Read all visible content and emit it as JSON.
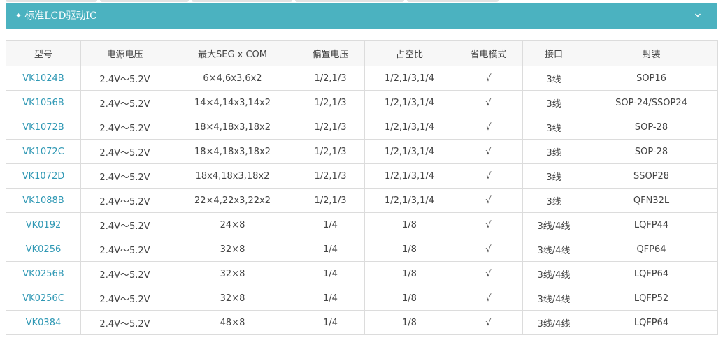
{
  "colors": {
    "header_bg": "#4bb2c0",
    "link": "#2f98b4",
    "border": "#dcdcdc",
    "th_bg": "#f7f7f7",
    "text": "#444444"
  },
  "panel": {
    "bullet": "✦",
    "title": "标准LCD驱动IC",
    "toggle_icon": "chevron-down-icon"
  },
  "table": {
    "headers": [
      "型号",
      "电源电压",
      "最大SEG x COM",
      "偏置电压",
      "占空比",
      "省电模式",
      "接口",
      "封装"
    ],
    "rows": [
      [
        "VK1024B",
        "2.4V～5.2V",
        "6×4,6x3,6x2",
        "1/2,1/3",
        "1/2,1/3,1/4",
        "√",
        "3线",
        "SOP16"
      ],
      [
        "VK1056B",
        "2.4V～5.2V",
        "14×4,14x3,14x2",
        "1/2,1/3",
        "1/2,1/3,1/4",
        "√",
        "3线",
        "SOP-24/SSOP24"
      ],
      [
        "VK1072B",
        "2.4V～5.2V",
        "18×4,18x3,18x2",
        "1/2,1/3",
        "1/2,1/3,1/4",
        "√",
        "3线",
        "SOP-28"
      ],
      [
        "VK1072C",
        "2.4V～5.2V",
        "18×4,18x3,18x2",
        "1/2,1/3",
        "1/2,1/3,1/4",
        "√",
        "3线",
        "SOP-28"
      ],
      [
        "VK1072D",
        "2.4V～5.2V",
        "18x4,18x3,18x2",
        "1/2,1/3",
        "1/2,1/3,1/4",
        "√",
        "3线",
        "SSOP28"
      ],
      [
        "VK1088B",
        "2.4V～5.2V",
        "22×4,22x3,22x2",
        "1/2,1/3",
        "1/2,1/3,1/4",
        "√",
        "3线",
        "QFN32L"
      ],
      [
        "VK0192",
        "2.4V～5.2V",
        "24×8",
        "1/4",
        "1/8",
        "√",
        "3线/4线",
        "LQFP44"
      ],
      [
        "VK0256",
        "2.4V～5.2V",
        "32×8",
        "1/4",
        "1/8",
        "√",
        "3线/4线",
        "QFP64"
      ],
      [
        "VK0256B",
        "2.4V～5.2V",
        "32×8",
        "1/4",
        "1/8",
        "√",
        "3线/4线",
        "LQFP64"
      ],
      [
        "VK0256C",
        "2.4V～5.2V",
        "32×8",
        "1/4",
        "1/8",
        "√",
        "3线/4线",
        "LQFP52"
      ],
      [
        "VK0384",
        "2.4V～5.2V",
        "48×8",
        "1/4",
        "1/8",
        "√",
        "3线/4线",
        "LQFP64"
      ]
    ]
  }
}
